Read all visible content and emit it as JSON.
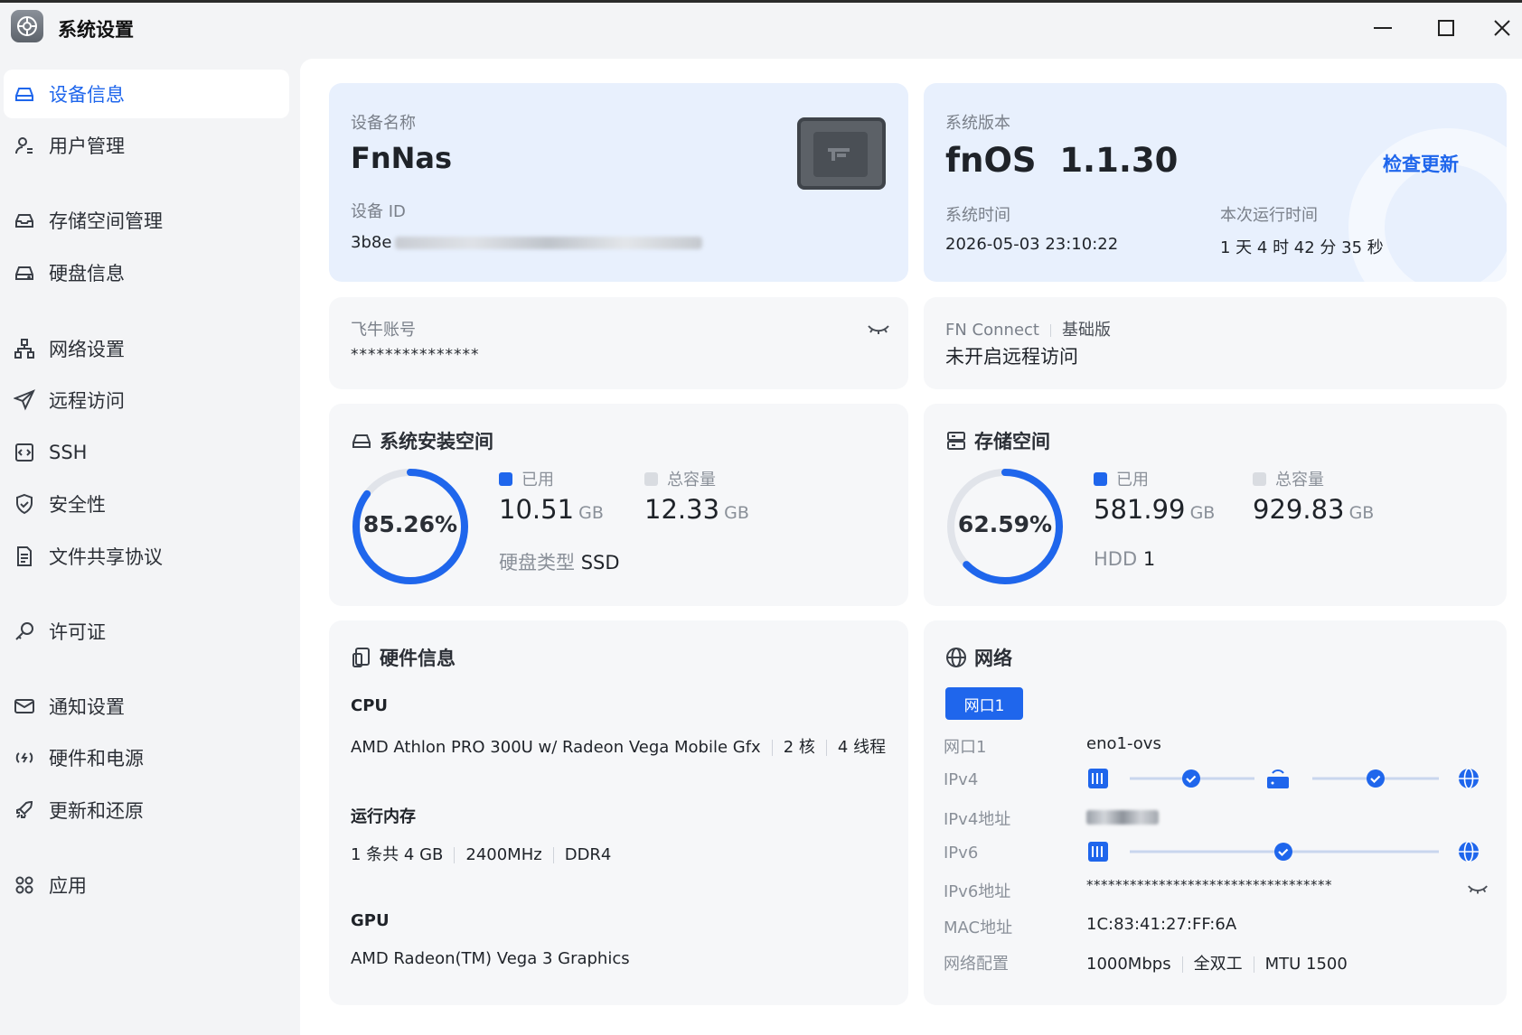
{
  "window": {
    "title": "系统设置"
  },
  "sidebar": {
    "items": [
      {
        "label": "设备信息",
        "icon": "device-icon",
        "active": true
      },
      {
        "label": "用户管理",
        "icon": "user-icon"
      },
      {
        "label": "存储空间管理",
        "icon": "storage-icon"
      },
      {
        "label": "硬盘信息",
        "icon": "disk-icon"
      },
      {
        "label": "网络设置",
        "icon": "network-icon"
      },
      {
        "label": "远程访问",
        "icon": "send-icon"
      },
      {
        "label": "SSH",
        "icon": "terminal-icon"
      },
      {
        "label": "安全性",
        "icon": "shield-icon"
      },
      {
        "label": "文件共享协议",
        "icon": "file-icon"
      },
      {
        "label": "许可证",
        "icon": "key-icon"
      },
      {
        "label": "通知设置",
        "icon": "mail-icon"
      },
      {
        "label": "硬件和电源",
        "icon": "power-icon"
      },
      {
        "label": "更新和还原",
        "icon": "rocket-icon"
      },
      {
        "label": "应用",
        "icon": "apps-icon"
      }
    ]
  },
  "device": {
    "name_label": "设备名称",
    "name": "FnNas",
    "id_label": "设备 ID",
    "id_visible": "3b8e"
  },
  "system": {
    "version_label": "系统版本",
    "os_name": "fnOS",
    "version": "1.1.30",
    "check_update": "检查更新",
    "time_label": "系统时间",
    "time": "2026-05-03 23:10:22",
    "uptime_label": "本次运行时间",
    "uptime": "1 天 4 时 42 分 35 秒"
  },
  "account": {
    "label": "飞牛账号",
    "value": "***************"
  },
  "fnconnect": {
    "label": "FN Connect",
    "tier": "基础版",
    "status": "未开启远程访问"
  },
  "install_space": {
    "title": "系统安装空间",
    "percent_text": "85.26%",
    "percent": 85.26,
    "used_label": "已用",
    "used_value": "10.51",
    "used_unit": "GB",
    "total_label": "总容量",
    "total_value": "12.33",
    "total_unit": "GB",
    "disk_type_label": "硬盘类型",
    "disk_type": "SSD"
  },
  "storage_space": {
    "title": "存储空间",
    "percent_text": "62.59%",
    "percent": 62.59,
    "used_label": "已用",
    "used_value": "581.99",
    "used_unit": "GB",
    "total_label": "总容量",
    "total_value": "929.83",
    "total_unit": "GB",
    "hdd_label": "HDD",
    "hdd_count": "1"
  },
  "hardware": {
    "title": "硬件信息",
    "cpu_label": "CPU",
    "cpu_model": "AMD Athlon PRO 300U w/ Radeon Vega Mobile Gfx",
    "cpu_cores": "2 核",
    "cpu_threads": "4 线程",
    "mem_label": "运行内存",
    "mem_size": "1 条共 4 GB",
    "mem_freq": "2400MHz",
    "mem_type": "DDR4",
    "gpu_label": "GPU",
    "gpu_model": "AMD Radeon(TM) Vega 3 Graphics"
  },
  "network": {
    "title": "网络",
    "tab": "网口1",
    "port_label": "网口1",
    "port_value": "eno1-ovs",
    "ipv4_label": "IPv4",
    "ipv4_addr_label": "IPv4地址",
    "ipv6_label": "IPv6",
    "ipv6_addr_label": "IPv6地址",
    "ipv6_addr": "**********************************",
    "mac_label": "MAC地址",
    "mac": "1C:83:41:27:FF:6A",
    "config_label": "网络配置",
    "speed": "1000Mbps",
    "duplex": "全双工",
    "mtu": "MTU 1500"
  },
  "colors": {
    "accent": "#1f66ec",
    "track": "#e1e4ea",
    "card": "#f6f7f9",
    "card_blue": "#e8f0fd"
  }
}
